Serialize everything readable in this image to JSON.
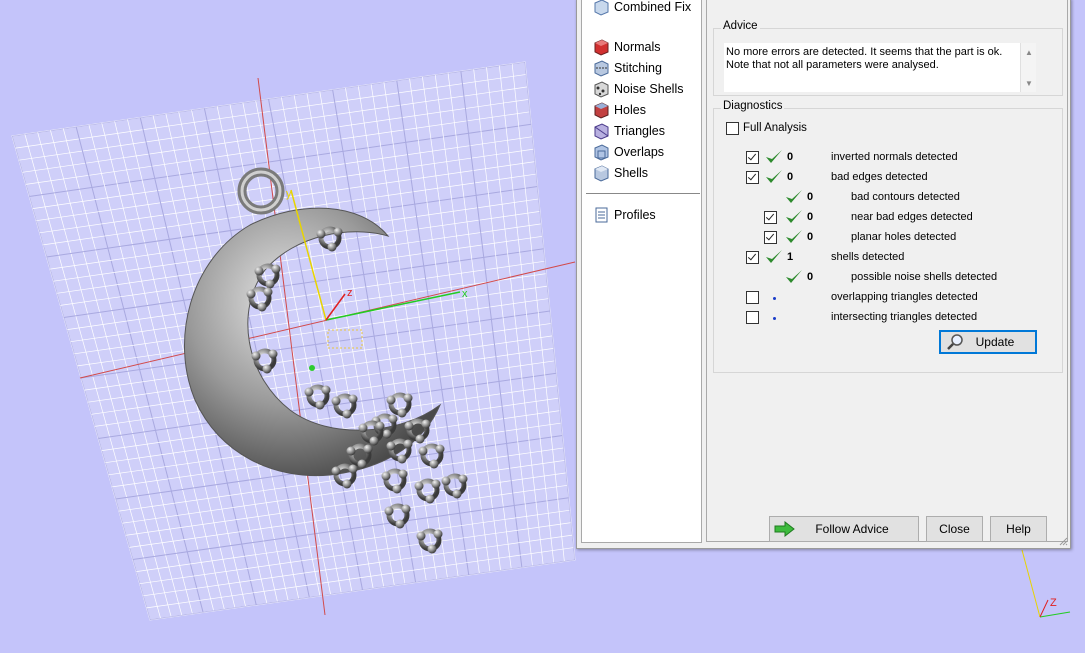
{
  "viewport": {
    "axis_labels": {
      "x": "x",
      "y": "y",
      "z": "z"
    },
    "corner_axis_label": "Z"
  },
  "nav": {
    "items": [
      {
        "label": "Combined Fix",
        "icon": "combined-fix-icon"
      },
      {
        "label": "Normals",
        "icon": "normals-icon"
      },
      {
        "label": "Stitching",
        "icon": "stitching-icon"
      },
      {
        "label": "Noise Shells",
        "icon": "noise-shells-icon"
      },
      {
        "label": "Holes",
        "icon": "holes-icon"
      },
      {
        "label": "Triangles",
        "icon": "triangles-icon"
      },
      {
        "label": "Overlaps",
        "icon": "overlaps-icon"
      },
      {
        "label": "Shells",
        "icon": "shells-icon"
      },
      {
        "label": "Profiles",
        "icon": "profiles-icon"
      }
    ]
  },
  "advice": {
    "legend": "Advice",
    "text_line1": "No more errors are detected. It seems that the part is ok.",
    "text_line2": "Note that not all parameters were analysed."
  },
  "diagnostics": {
    "legend": "Diagnostics",
    "full_analysis_label": "Full Analysis",
    "full_analysis_checked": false,
    "rows": [
      {
        "checkbox": true,
        "checked": true,
        "status": "ok",
        "count": "0",
        "label": "inverted normals detected"
      },
      {
        "checkbox": true,
        "checked": true,
        "status": "ok",
        "count": "0",
        "label": "bad edges detected"
      },
      {
        "checkbox": false,
        "checked": false,
        "status": "ok",
        "count": "0",
        "label": "bad contours detected"
      },
      {
        "checkbox": true,
        "checked": true,
        "status": "ok",
        "count": "0",
        "label": "near bad edges detected"
      },
      {
        "checkbox": true,
        "checked": true,
        "status": "ok",
        "count": "0",
        "label": "planar holes detected"
      },
      {
        "checkbox": true,
        "checked": true,
        "status": "ok",
        "count": "1",
        "label": "shells detected"
      },
      {
        "checkbox": false,
        "checked": false,
        "status": "ok",
        "count": "0",
        "label": "possible noise shells detected"
      },
      {
        "checkbox": true,
        "checked": false,
        "status": "pending",
        "count": "",
        "label": "overlapping triangles detected"
      },
      {
        "checkbox": true,
        "checked": false,
        "status": "pending",
        "count": "",
        "label": "intersecting triangles detected"
      }
    ],
    "update_label": "Update"
  },
  "buttons": {
    "follow_advice": "Follow Advice",
    "close": "Close",
    "help": "Help"
  },
  "colors": {
    "background": "#c4c4fa",
    "grid": "#ffffff",
    "ok_check": "#2e8b2e",
    "pending_dot": "#1a3cc8"
  }
}
